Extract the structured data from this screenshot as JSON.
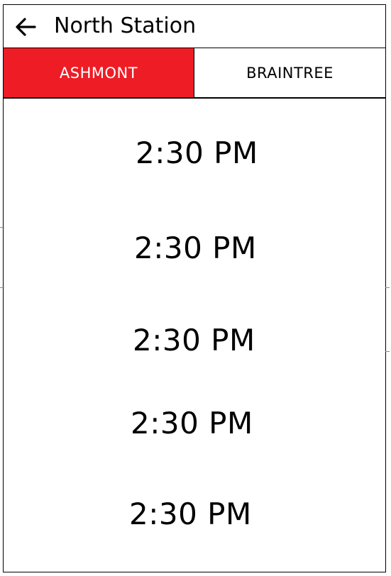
{
  "header": {
    "title": "North Station",
    "back_icon": "arrow-left-icon"
  },
  "tabs": [
    {
      "label": "ASHMONT",
      "active": true
    },
    {
      "label": "BRAINTREE",
      "active": false
    }
  ],
  "colors": {
    "accent": "#ee1c25",
    "text": "#000000",
    "background": "#ffffff"
  },
  "times": [
    "2:30 PM",
    "2:30 PM",
    "2:30 PM",
    "2:30 PM",
    "2:30 PM"
  ]
}
